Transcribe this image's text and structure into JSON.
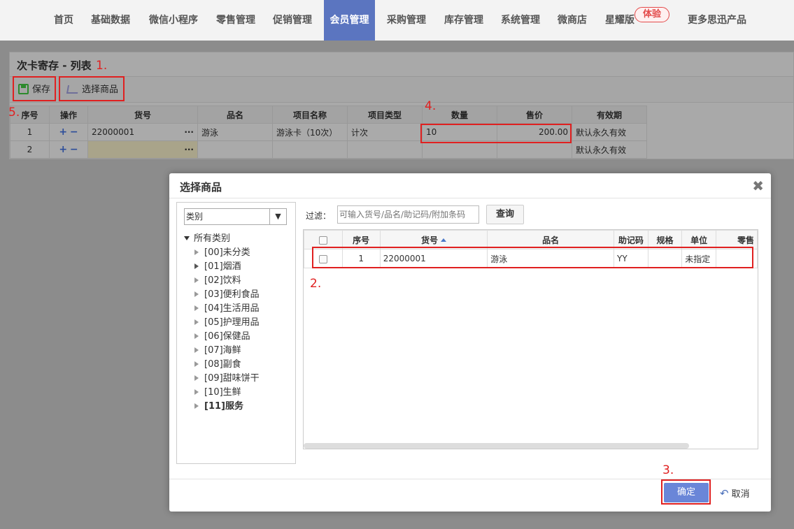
{
  "nav": {
    "items": [
      "首页",
      "基础数据",
      "微信小程序",
      "零售管理",
      "促销管理",
      "会员管理",
      "采购管理",
      "库存管理",
      "系统管理",
      "微商店",
      "星耀版",
      "更多思迅产品"
    ],
    "badge": "体验",
    "active_color": "#5b75c0"
  },
  "panel": {
    "title": "次卡寄存 - 列表",
    "save_label": "保存",
    "select_goods_label": "选择商品",
    "columns": [
      "序号",
      "操作",
      "货号",
      "品名",
      "项目名称",
      "项目类型",
      "数量",
      "售价",
      "有效期"
    ],
    "rows": [
      {
        "no": "1",
        "code": "22000001",
        "dots": "···",
        "name": "游泳",
        "item_name": "游泳卡（10次）",
        "item_type": "计次",
        "qty": "10",
        "price": "200.00",
        "validity": "默认永久有效"
      },
      {
        "no": "2",
        "code": "",
        "dots": "···",
        "name": "",
        "item_name": "",
        "item_type": "",
        "qty": "",
        "price": "",
        "validity": "默认永久有效"
      }
    ],
    "plus": "+",
    "minus": "−"
  },
  "annotations": [
    "1.",
    "2.",
    "3.",
    "4.",
    "5."
  ],
  "dialog": {
    "title": "选择商品",
    "close": "✖",
    "category_select": "类别",
    "tree_root": "所有类别",
    "categories": [
      "[00]未分类",
      "[01]烟酒",
      "[02]饮料",
      "[03]便利食品",
      "[04]生活用品",
      "[05]护理用品",
      "[06]保健品",
      "[07]海鲜",
      "[08]副食",
      "[09]甜味饼干",
      "[10]生鲜",
      "[11]服务"
    ],
    "filter_label": "过滤：",
    "filter_placeholder": "可输入货号/品名/助记码/附加条码",
    "query_label": "查询",
    "columns": [
      "序号",
      "货号",
      "品名",
      "助记码",
      "规格",
      "单位",
      "零售"
    ],
    "rows": [
      {
        "no": "1",
        "code": "22000001",
        "name": "游泳",
        "mnemonic": "YY",
        "spec": "",
        "unit": "未指定",
        "retail": ""
      }
    ],
    "ok_label": "确定",
    "cancel_label": "取消"
  }
}
